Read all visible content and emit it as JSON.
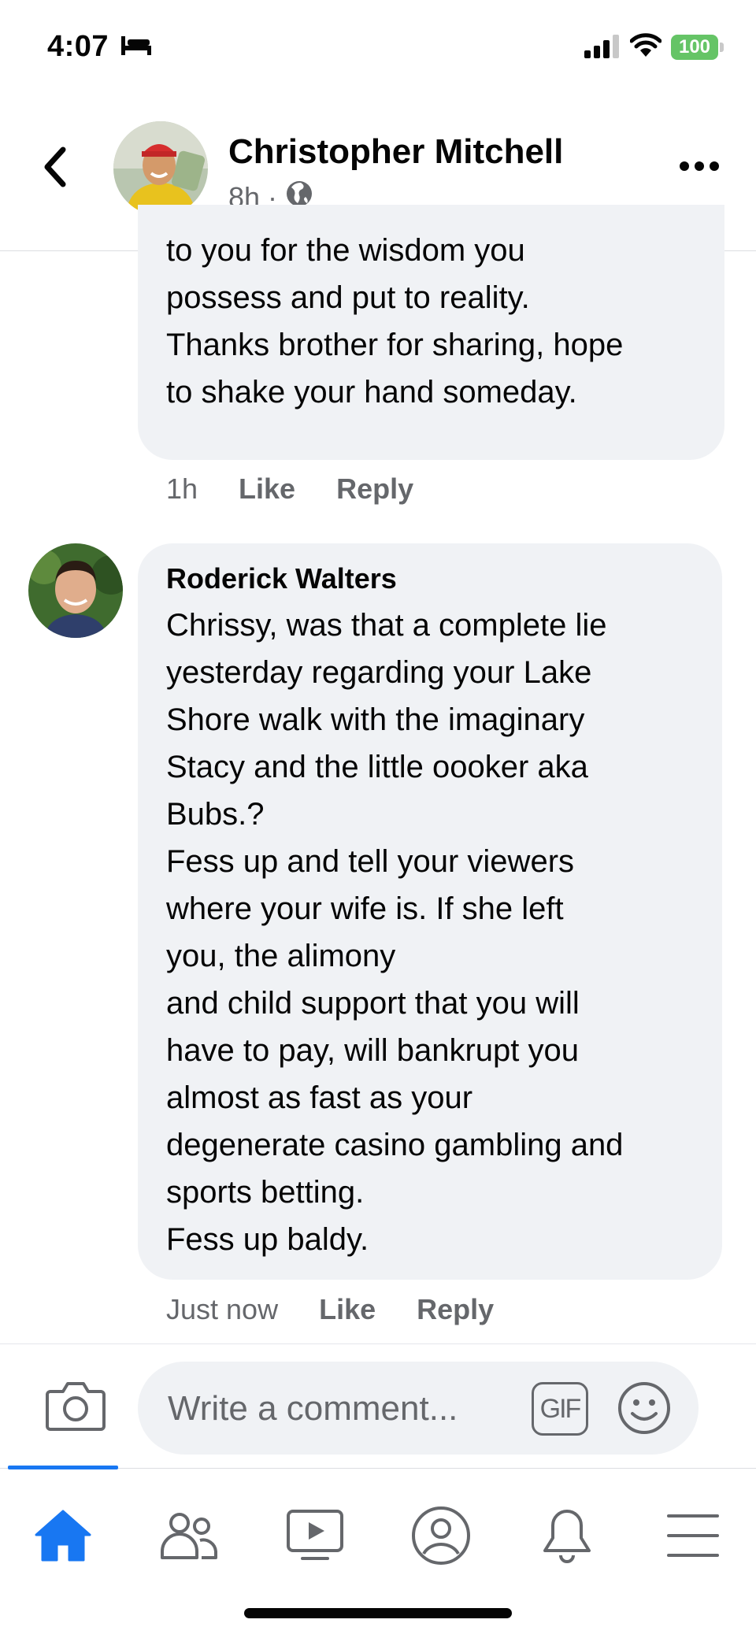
{
  "status_bar": {
    "time": "4:07",
    "battery": "100",
    "icons": [
      "bed-icon",
      "signal-icon",
      "wifi-icon",
      "battery-icon"
    ]
  },
  "header": {
    "author": "Christopher Mitchell",
    "time_ago": "8h",
    "separator": "·",
    "privacy_icon": "globe-icon",
    "more_icon": "more-icon",
    "back_icon": "back-icon"
  },
  "comments": [
    {
      "author": "",
      "text": "to you for the wisdom you\npossess and put to reality.\nThanks brother for sharing, hope\nto shake your hand someday.",
      "time": "1h",
      "like_label": "Like",
      "reply_label": "Reply"
    },
    {
      "author": "Roderick Walters",
      "text": "Chrissy, was that a complete lie\nyesterday regarding your Lake\nShore walk with the imaginary\nStacy and the little oooker aka\nBubs.?\nFess up and tell your viewers\nwhere your wife is. If she left\nyou, the alimony\nand child support that you will\nhave to pay, will bankrupt you\nalmost as fast as your\ndegenerate casino gambling and\nsports betting.\nFess up baldy.",
      "time": "Just now",
      "like_label": "Like",
      "reply_label": "Reply"
    }
  ],
  "composer": {
    "placeholder": "Write a comment...",
    "gif_label": "GIF",
    "camera_icon": "camera-icon",
    "emoji_icon": "emoji-icon"
  },
  "tabbar": {
    "tabs": [
      "home-icon",
      "friends-icon",
      "video-icon",
      "profile-icon",
      "notifications-icon",
      "menu-icon"
    ],
    "active": "home-icon"
  },
  "colors": {
    "accent": "#1877f2",
    "secondary_text": "#65676b",
    "bubble_bg": "#f0f2f5",
    "battery": "#65c466"
  }
}
